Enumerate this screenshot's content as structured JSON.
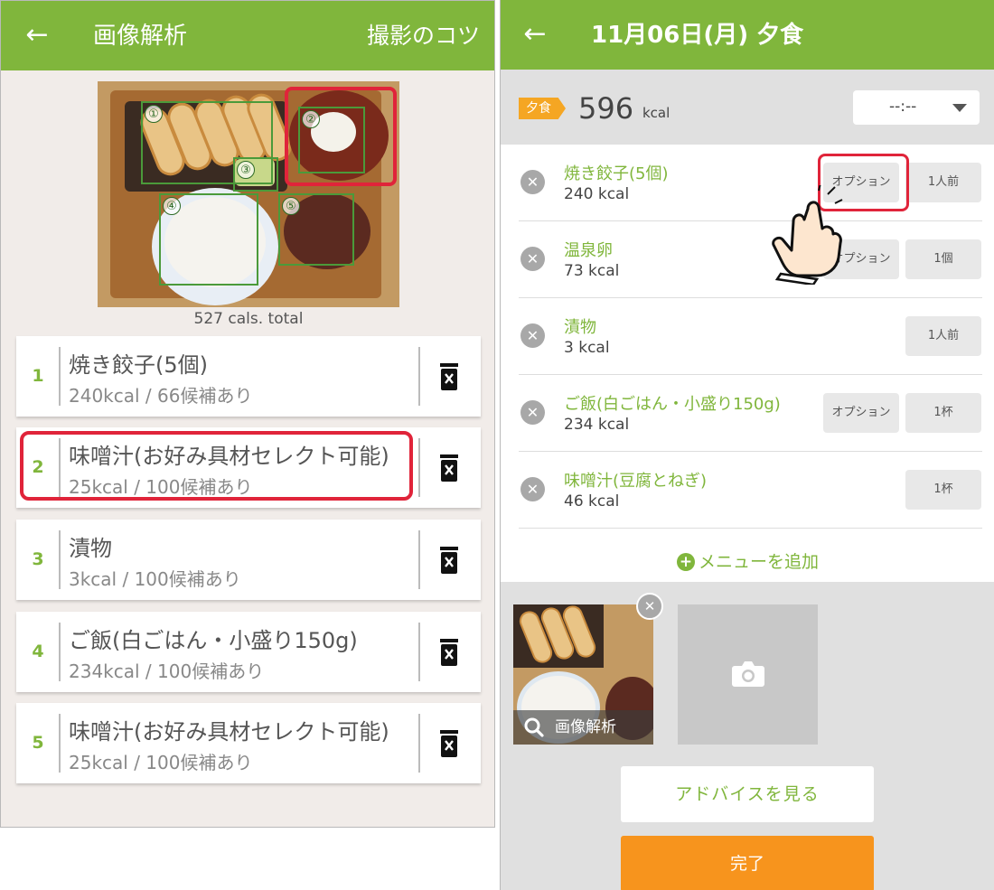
{
  "left": {
    "header": {
      "title": "画像解析",
      "tips": "撮影のコツ"
    },
    "photo_caption": "527 cals. total",
    "detections": [
      "①",
      "②",
      "③",
      "④",
      "⑤"
    ],
    "items": [
      {
        "index": "1",
        "name": "焼き餃子(5個)",
        "detail": "240kcal / 66候補あり"
      },
      {
        "index": "2",
        "name": "味噌汁(お好み具材セレクト可能)",
        "detail": "25kcal / 100候補あり"
      },
      {
        "index": "3",
        "name": "漬物",
        "detail": "3kcal / 100候補あり"
      },
      {
        "index": "4",
        "name": "ご飯(白ごはん・小盛り150g)",
        "detail": "234kcal / 100候補あり"
      },
      {
        "index": "5",
        "name": "味噌汁(お好み具材セレクト可能)",
        "detail": "25kcal / 100候補あり"
      }
    ]
  },
  "right": {
    "header": {
      "title": "11月06日(月) 夕食"
    },
    "meal_badge": "夕食",
    "total_kcal": "596",
    "kcal_unit": "kcal",
    "time_value": "--:--",
    "items": [
      {
        "name": "焼き餃子(5個)",
        "kcal": "240 kcal",
        "option": "オプション",
        "qty": "1人前"
      },
      {
        "name": "温泉卵",
        "kcal": "73 kcal",
        "option": "オプション",
        "qty": "1個"
      },
      {
        "name": "漬物",
        "kcal": "3 kcal",
        "option": "",
        "qty": "1人前"
      },
      {
        "name": "ご飯(白ごはん・小盛り150g)",
        "kcal": "234 kcal",
        "option": "オプション",
        "qty": "1杯"
      },
      {
        "name": "味噌汁(豆腐とねぎ)",
        "kcal": "46 kcal",
        "option": "",
        "qty": "1杯"
      }
    ],
    "add_menu": "メニューを追加",
    "image_analysis_label": "画像解析",
    "advice_button": "アドバイスを見る",
    "done_button": "完了"
  },
  "colors": {
    "brand_green": "#80b63c",
    "highlight_red": "#e0243a",
    "done_orange": "#f7941d",
    "meal_badge": "#f5a623"
  },
  "icons": [
    "back-arrow-icon",
    "trash-icon",
    "remove-icon",
    "plus-circle-icon",
    "search-icon",
    "camera-icon",
    "dropdown-caret-icon",
    "pointing-hand-icon"
  ]
}
